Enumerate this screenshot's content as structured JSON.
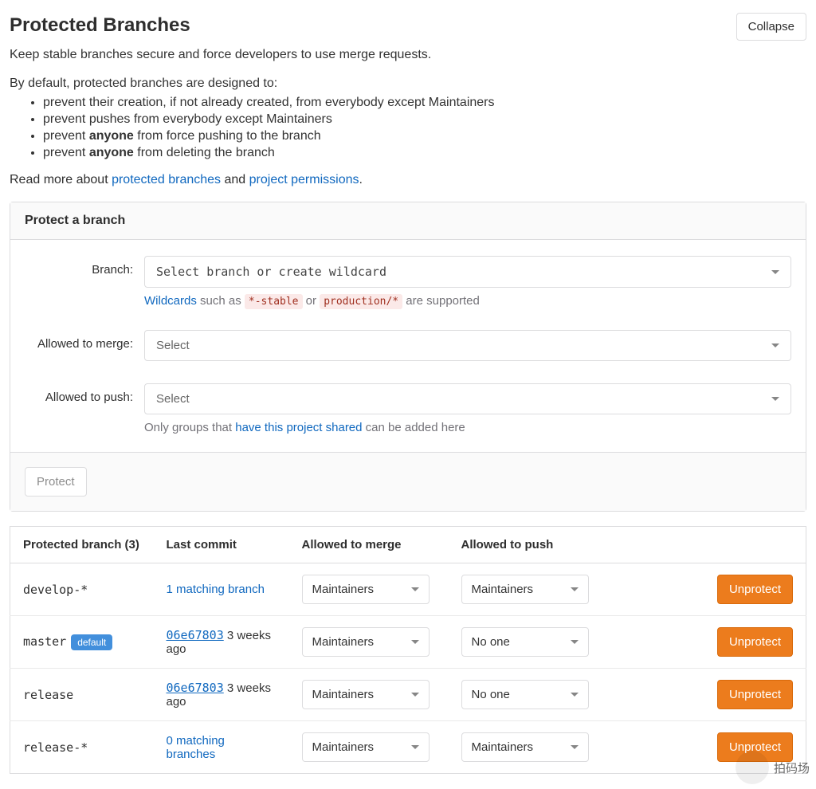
{
  "header": {
    "title": "Protected Branches",
    "collapse": "Collapse"
  },
  "intro": {
    "subtitle": "Keep stable branches secure and force developers to use merge requests.",
    "designed_to": "By default, protected branches are designed to:",
    "rules": [
      "prevent their creation, if not already created, from everybody except Maintainers",
      "prevent pushes from everybody except Maintainers",
      "prevent ##anyone## from force pushing to the branch",
      "prevent ##anyone## from deleting the branch"
    ],
    "read_more_prefix": "Read more about ",
    "read_more_link1": "protected branches",
    "read_more_mid": " and ",
    "read_more_link2": "project permissions",
    "read_more_suffix": "."
  },
  "protect_panel": {
    "title": "Protect a branch",
    "branch_label": "Branch:",
    "branch_placeholder": "Select branch or create wildcard",
    "branch_help_link": "Wildcards",
    "branch_help_1": " such as ",
    "branch_help_code1": "*-stable",
    "branch_help_2": " or ",
    "branch_help_code2": "production/*",
    "branch_help_3": " are supported",
    "merge_label": "Allowed to merge:",
    "merge_placeholder": "Select",
    "push_label": "Allowed to push:",
    "push_placeholder": "Select",
    "push_help_1": "Only groups that ",
    "push_help_link": "have this project shared",
    "push_help_2": " can be added here",
    "protect_button": "Protect"
  },
  "table": {
    "headers": {
      "branch": "Protected branch (3)",
      "commit": "Last commit",
      "merge": "Allowed to merge",
      "push": "Allowed to push",
      "action": ""
    },
    "rows": [
      {
        "name": "develop-*",
        "default": false,
        "commit_link": "1 matching branch",
        "commit_time": "",
        "merge": "Maintainers",
        "push": "Maintainers",
        "action": "Unprotect"
      },
      {
        "name": "master",
        "default": true,
        "default_label": "default",
        "commit_link": "06e67803",
        "commit_time": "3 weeks ago",
        "merge": "Maintainers",
        "push": "No one",
        "action": "Unprotect"
      },
      {
        "name": "release",
        "default": false,
        "commit_link": "06e67803",
        "commit_time": "3 weeks ago",
        "merge": "Maintainers",
        "push": "No one",
        "action": "Unprotect"
      },
      {
        "name": "release-*",
        "default": false,
        "commit_link": "0 matching branches",
        "commit_time": "",
        "merge": "Maintainers",
        "push": "Maintainers",
        "action": "Unprotect"
      }
    ]
  },
  "watermark": "拍码场"
}
